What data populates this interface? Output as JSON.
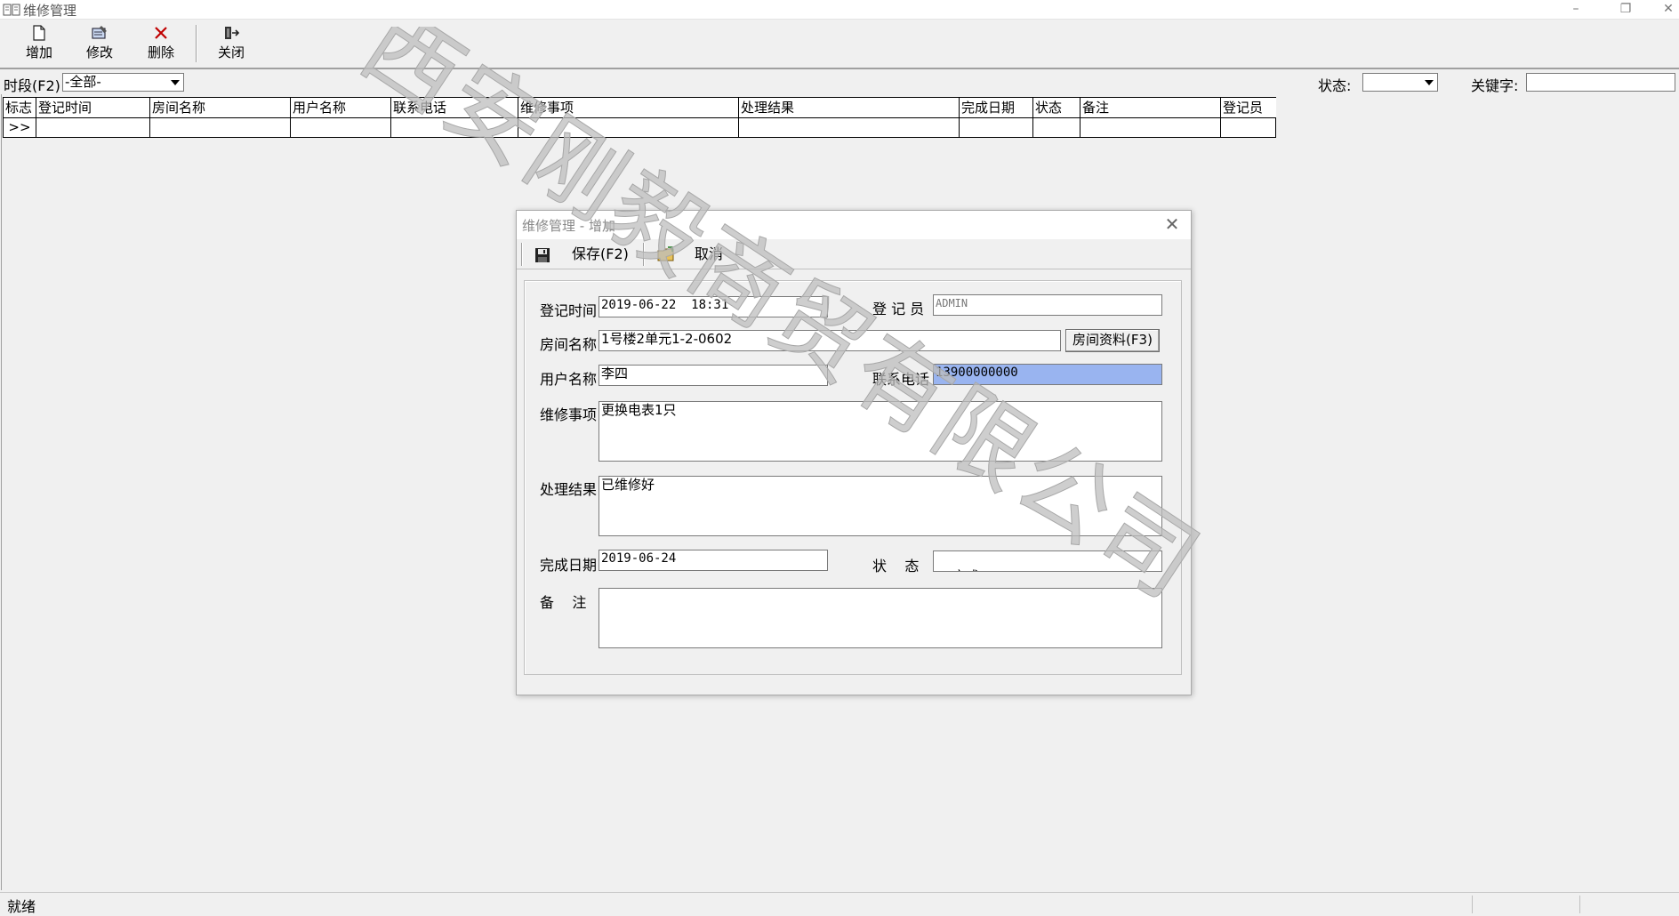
{
  "window": {
    "title": "维修管理"
  },
  "toolbar": {
    "add_label": "增加",
    "edit_label": "修改",
    "delete_label": "删除",
    "close_label": "关闭"
  },
  "filter": {
    "period_label": "时段(F2)",
    "period_value": "-全部-",
    "status_label": "状态:",
    "status_value": "",
    "keyword_label": "关键字:",
    "keyword_value": ""
  },
  "grid": {
    "columns": [
      "标志",
      "登记时间",
      "房间名称",
      "用户名称",
      "联系电话",
      "维修事项",
      "处理结果",
      "完成日期",
      "状态",
      "备注",
      "登记员"
    ],
    "row_indicator": ">>"
  },
  "dialog": {
    "title": "维修管理 - 增加",
    "save_label": "保存(F2)",
    "cancel_label": "取消",
    "fields": {
      "reg_time_label": "登记时间",
      "reg_time_value": "2019-06-22  18:31",
      "registrar_label": "登 记 员",
      "registrar_value": "ADMIN",
      "room_label": "房间名称",
      "room_value": "1号楼2单元1-2-0602",
      "room_button": "房间资料(F3)",
      "user_label": "用户名称",
      "user_value": "李四",
      "phone_label": "联系电话",
      "phone_value": "13900000000",
      "repair_label": "维修事项",
      "repair_value": "更换电表1只",
      "result_label": "处理结果",
      "result_value": "已维修好",
      "done_date_label": "完成日期",
      "done_date_value": "2019-06-24",
      "status_label": "状    态",
      "status_value": "完成",
      "remark_label": "备    注",
      "remark_value": ""
    }
  },
  "statusbar": {
    "text": "就绪"
  },
  "watermark": {
    "text": "西安刚毅商贸有限公司",
    "color": "#bdbdbd"
  }
}
